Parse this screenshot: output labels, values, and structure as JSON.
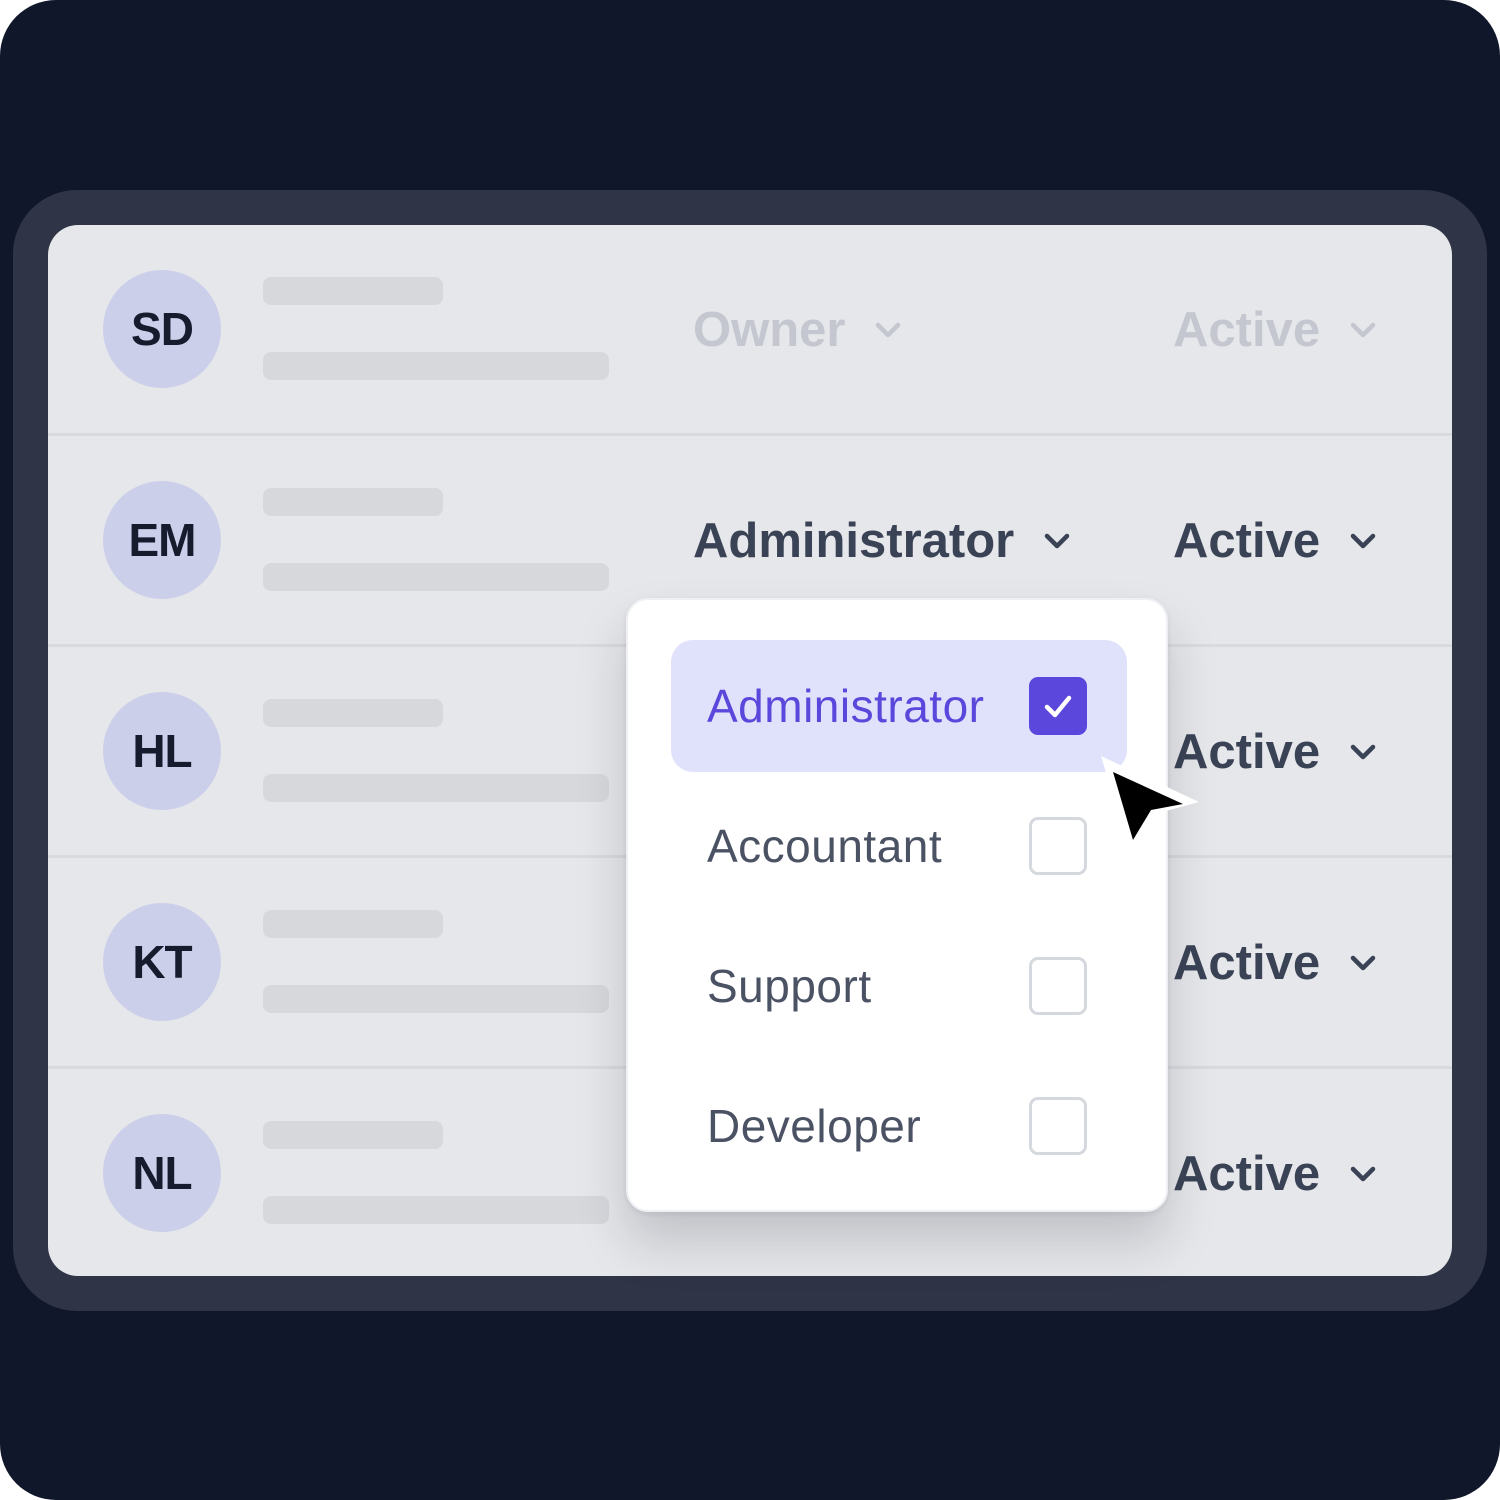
{
  "users": [
    {
      "initials": "SD",
      "role": "Owner",
      "status": "Active",
      "dimmed": true
    },
    {
      "initials": "EM",
      "role": "Administrator",
      "status": "Active",
      "dimmed": false
    },
    {
      "initials": "HL",
      "role": "",
      "status": "Active",
      "dimmed": false
    },
    {
      "initials": "KT",
      "role": "",
      "status": "Active",
      "dimmed": false
    },
    {
      "initials": "NL",
      "role": "",
      "status": "Active",
      "dimmed": false
    }
  ],
  "role_menu": {
    "options": [
      {
        "label": "Administrator",
        "checked": true
      },
      {
        "label": "Accountant",
        "checked": false
      },
      {
        "label": "Support",
        "checked": false
      },
      {
        "label": "Developer",
        "checked": false
      }
    ]
  },
  "colors": {
    "background": "#11172a",
    "frame": "#2f3546",
    "card": "#e6e7ea",
    "avatar": "#cbcfe9",
    "accent": "#5b47dc",
    "selected_bg": "#e0e2fb"
  },
  "icons": {
    "dropdown": "chevron-down-icon",
    "check": "check-icon",
    "pointer": "mouse-pointer-icon"
  }
}
